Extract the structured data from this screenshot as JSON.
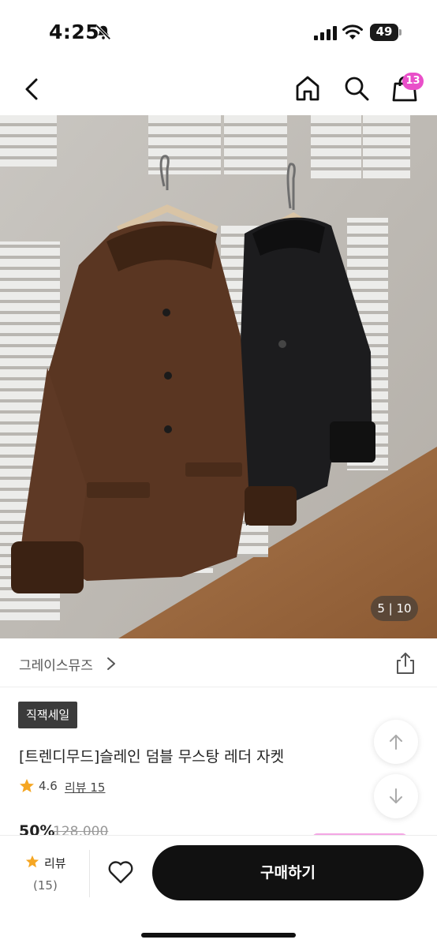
{
  "status_bar": {
    "time": "4:25",
    "battery": "49"
  },
  "nav": {
    "cart_count": "13"
  },
  "gallery": {
    "counter": "5 | 10"
  },
  "shop": {
    "name": "그레이스뮤즈"
  },
  "product": {
    "sale_badge": "직잭세일",
    "title": "[트렌디무드]슬레인 덤블 무스탕 레더 자켓",
    "rating": "4.6",
    "review_link": "리뷰 15",
    "discount_rate": "50%",
    "original_price": "128,000"
  },
  "bottom_bar": {
    "review_label": "리뷰",
    "review_count": "(15)",
    "buy_label": "구매하기"
  },
  "colors": {
    "accent": "#e94fc9",
    "star": "#f5a623",
    "buy_button": "#111111"
  }
}
